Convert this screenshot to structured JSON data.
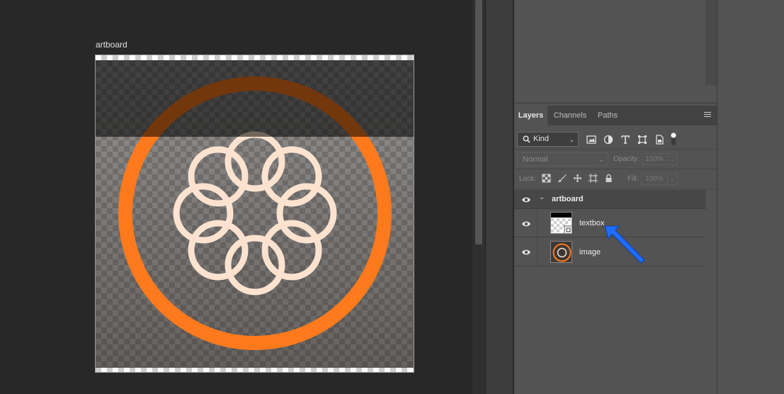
{
  "canvas": {
    "artboard_label": "artboard"
  },
  "layers_panel": {
    "tabs": [
      {
        "label": "Layers",
        "active": true
      },
      {
        "label": "Channels",
        "active": false
      },
      {
        "label": "Paths",
        "active": false
      }
    ],
    "filter": {
      "kind_label": "Kind"
    },
    "blend_mode": "Normal",
    "opacity_label": "Opacity:",
    "opacity_value": "100%",
    "lock_label": "Lock:",
    "fill_label": "Fill:",
    "fill_value": "100%",
    "layers": [
      {
        "name": "artboard",
        "type": "artboard-group",
        "visible": true,
        "expanded": true
      },
      {
        "name": "textbox",
        "type": "layer",
        "visible": true
      },
      {
        "name": "image",
        "type": "layer",
        "visible": true
      }
    ]
  },
  "colors": {
    "accent_orange": "#ff7a1c",
    "logo_cream": "#fde3cf",
    "annotation_arrow": "#1f6dff"
  }
}
